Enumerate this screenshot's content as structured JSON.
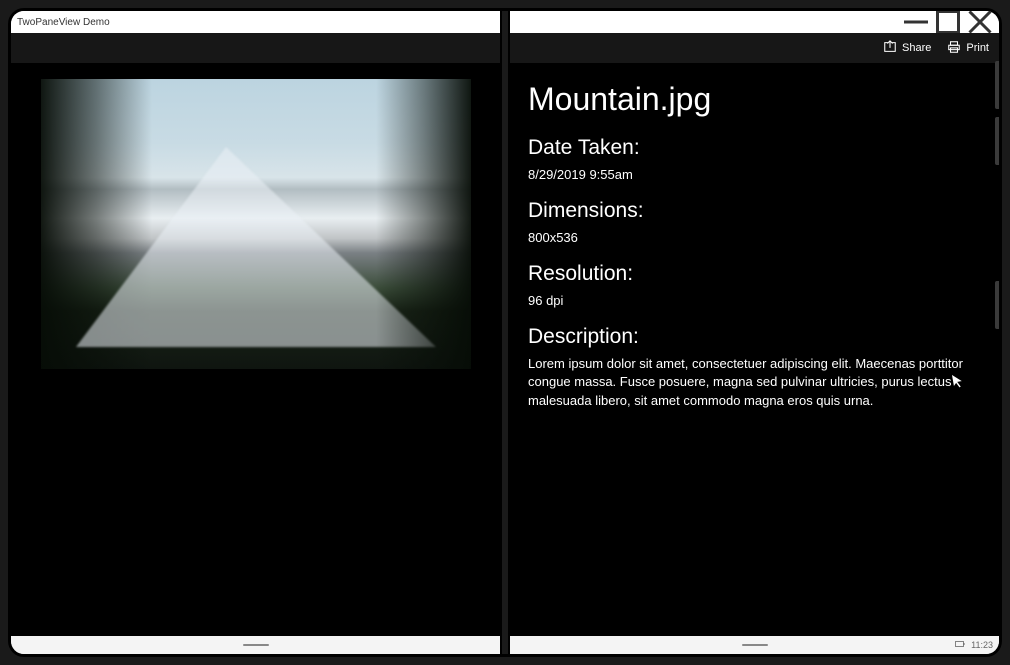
{
  "window": {
    "title": "TwoPaneView Demo",
    "clock": "11:23"
  },
  "toolbar": {
    "share_label": "Share",
    "print_label": "Print"
  },
  "details": {
    "filename": "Mountain.jpg",
    "date_taken_label": "Date Taken:",
    "date_taken_value": "8/29/2019 9:55am",
    "dimensions_label": "Dimensions:",
    "dimensions_value": "800x536",
    "resolution_label": "Resolution:",
    "resolution_value": "96 dpi",
    "description_label": "Description:",
    "description_value": "Lorem ipsum dolor sit amet, consectetuer adipiscing elit. Maecenas porttitor congue massa. Fusce posuere, magna sed pulvinar ultricies, purus lectus malesuada libero, sit amet commodo magna eros quis urna."
  }
}
